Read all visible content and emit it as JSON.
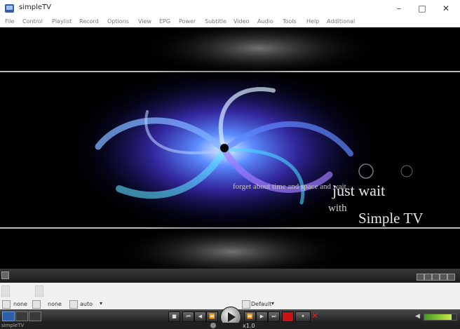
{
  "window": {
    "title": "simpleTV",
    "minimize_icon": "minimize-icon",
    "maximize_icon": "maximize-icon",
    "close_icon": "close-icon"
  },
  "menu": [
    "File",
    "Control",
    "Playlist",
    "Record",
    "Options",
    "View",
    "EPG",
    "Power",
    "Subtitle",
    "Video",
    "Audio",
    "Tools",
    "Help",
    "Additional"
  ],
  "video": {
    "tagline": "forget about time and space and wait",
    "just_wait": "just wait",
    "with": "with",
    "brand": "Simple TV"
  },
  "options_bar": {
    "aspect_value": "none",
    "crop_value": "none",
    "zoom_value": "auto",
    "profile_value": "Default"
  },
  "playback": {
    "speed": "x1.0"
  },
  "statusbar": {
    "app_label": "simpleTV"
  },
  "icons": {
    "play": "play-icon",
    "stop": "stop-icon",
    "prev": "skip-back-icon",
    "rewind": "rewind-icon",
    "forward": "fast-forward-icon",
    "next": "skip-forward-icon",
    "record": "record-icon",
    "close_red": "close-icon",
    "volume": "speaker-icon"
  },
  "colors": {
    "record": "#cc1111",
    "volume_fill": "#8fcf3a",
    "accent": "#3b7fd4"
  }
}
